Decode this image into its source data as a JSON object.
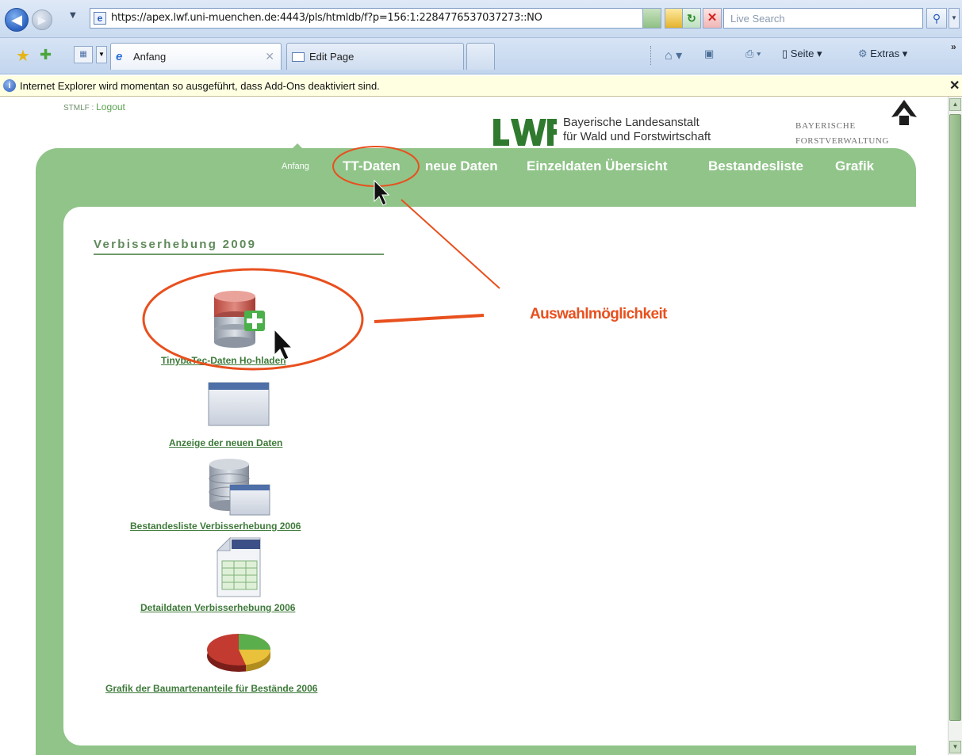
{
  "browser": {
    "url": "https://apex.lwf.uni-muenchen.de:4443/pls/htmldb/f?p=156:1:2284776537037273::NO",
    "search_placeholder": "Live Search",
    "tabs": [
      {
        "label": "Anfang",
        "active": true
      },
      {
        "label": "Edit Page",
        "active": false
      }
    ],
    "commands": {
      "page": "Seite",
      "tools": "Extras"
    },
    "infobar_text": "Internet Explorer wird momentan so ausgeführt, dass Add-Ons deaktiviert sind."
  },
  "header": {
    "user_prefix": "STMLF :",
    "logout": "Logout",
    "lwf_line1": "Bayerische Landesanstalt",
    "lwf_line2": "für Wald und Forstwirtschaft",
    "bay_line1": "BAYERISCHE",
    "bay_line2": "FORSTVERWALTUNG"
  },
  "topnav": [
    {
      "label": "Anfang"
    },
    {
      "label": "TT-Daten"
    },
    {
      "label": "neue Daten"
    },
    {
      "label": "Einzeldaten Übersicht"
    },
    {
      "label": "Bestandesliste"
    },
    {
      "label": "Grafik"
    }
  ],
  "section": {
    "title": "Verbisserhebung 2009"
  },
  "items": [
    {
      "label": "TinybaTec-Daten Ho-hladen",
      "icon": "database-add-icon"
    },
    {
      "label": "Anzeige der neuen Daten",
      "icon": "window-icon"
    },
    {
      "label": "Bestandesliste Verbisserhebung 2006",
      "icon": "database-window-icon"
    },
    {
      "label": "Detaildaten Verbisserhebung 2006",
      "icon": "spreadsheet-icon"
    },
    {
      "label": "Grafik der Baumartenanteile für Bestände 2006",
      "icon": "pie-chart-icon"
    }
  ],
  "annotation": {
    "label": "Auswahlmöglichkeit",
    "color": "#e8501e"
  },
  "colors": {
    "frame_green": "#90c489",
    "link_green": "#3e7a3a"
  }
}
